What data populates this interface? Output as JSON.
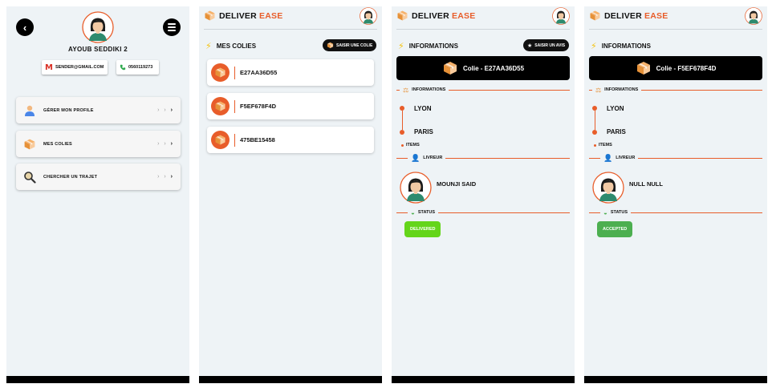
{
  "colors": {
    "accent": "#e85d2a",
    "delivered": "#64d51a",
    "accepted": "#4caf50",
    "dark": "#111111",
    "bg": "#eef3f6"
  },
  "profile": {
    "name": "AYOUB SEDDIKI 2",
    "email": "SENDER@GMAIL.COM",
    "phone": "0560119273",
    "menu": [
      {
        "label": "GÉRER MON PROFILE",
        "icon": "user-icon"
      },
      {
        "label": "MES COLIES",
        "icon": "package-icon"
      },
      {
        "label": "CHERCHER UN TRAJET",
        "icon": "search-icon"
      }
    ]
  },
  "brand": {
    "part1": "DELIVER",
    "part2": "EASE"
  },
  "list": {
    "title": "MES COLIES",
    "action": "SAISIR UNE COLIE",
    "parcels": [
      "E27AA36D55",
      "F5EF678F4D",
      "475BE15458"
    ]
  },
  "details": [
    {
      "title": "INFORMATIONS",
      "action": "SAISIR UN AVIS",
      "banner": "Colie - E27AA36D55",
      "info_label": "INFORMATIONS",
      "from": "LYON",
      "to": "PARIS",
      "items_label": "ITEMS",
      "driver_label": "LIVREUR",
      "driver_name": "MOUNJI SAID",
      "status_label": "STATUS",
      "status": "DELIVERED"
    },
    {
      "title": "INFORMATIONS",
      "banner": "Colie - F5EF678F4D",
      "info_label": "INFORMATIONS",
      "from": "LYON",
      "to": "PARIS",
      "items_label": "ITEMS",
      "driver_label": "LIVREUR",
      "driver_name": "NULL NULL",
      "status_label": "STATUS",
      "status": "ACCEPTED"
    }
  ]
}
